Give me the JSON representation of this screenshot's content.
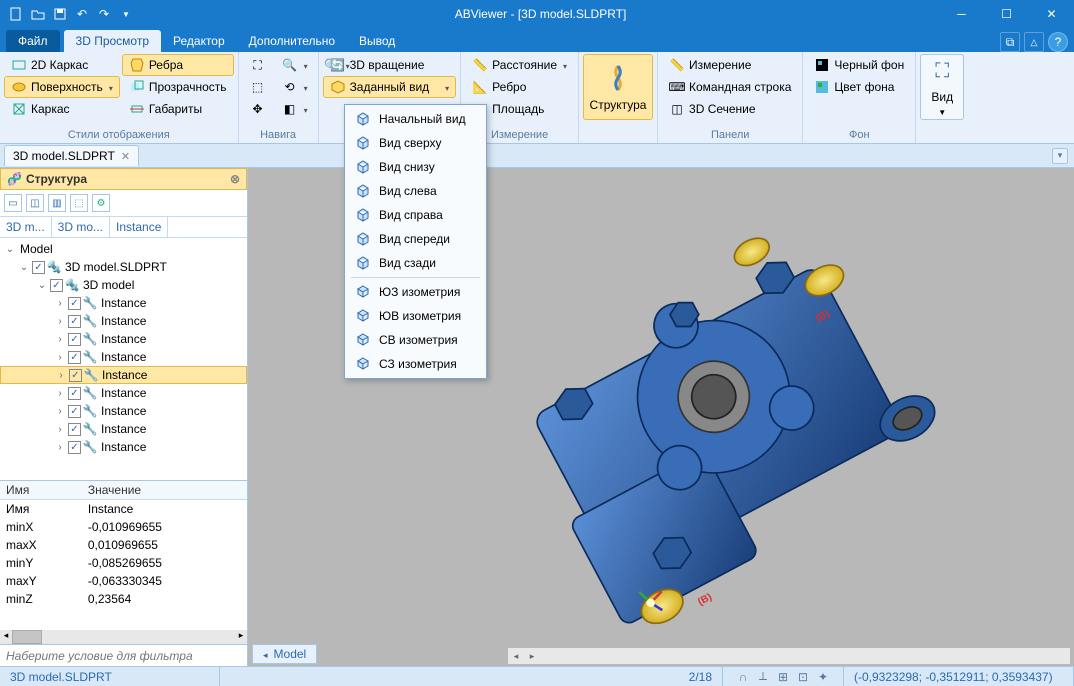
{
  "titlebar": {
    "title": "ABViewer  - [3D model.SLDPRT]"
  },
  "tabs": {
    "file": "Файл",
    "items": [
      "3D Просмотр",
      "Редактор",
      "Дополнительно",
      "Вывод"
    ],
    "active": 0
  },
  "ribbon": {
    "styles": {
      "label": "Стили отображения",
      "btn_wireframe": "2D Каркас",
      "btn_edges": "Ребра",
      "btn_surface": "Поверхность",
      "btn_transparency": "Прозрачность",
      "btn_frame": "Каркас",
      "btn_dims": "Габариты"
    },
    "nav": {
      "label": "Навига"
    },
    "rotate": {
      "btn_rotate": "3D вращение",
      "btn_view": "Заданный вид"
    },
    "measure": {
      "label": "Измерение",
      "btn_distance": "Расстояние",
      "btn_edge": "Ребро",
      "btn_area": "Площадь"
    },
    "structure": {
      "btn": "Структура"
    },
    "panels": {
      "label": "Панели",
      "btn_measure": "Измерение",
      "btn_cmd": "Командная строка",
      "btn_section": "3D Сечение"
    },
    "background": {
      "label": "Фон",
      "btn_black": "Черный фон",
      "btn_color": "Цвет фона"
    },
    "view": {
      "btn": "Вид"
    }
  },
  "dropdown": {
    "items": [
      "Начальный вид",
      "Вид сверху",
      "Вид снизу",
      "Вид слева",
      "Вид справа",
      "Вид спереди",
      "Вид сзади"
    ],
    "iso": [
      "ЮЗ изометрия",
      "ЮВ изометрия",
      "СВ изометрия",
      "СЗ изометрия"
    ]
  },
  "doctab": "3D model.SLDPRT",
  "structure_panel": {
    "title": "Структура",
    "headers": [
      "3D m...",
      "3D mo...",
      "Instance"
    ],
    "tree": {
      "root": "Model",
      "file": "3D model.SLDPRT",
      "model": "3D model",
      "instances": [
        "Instance",
        "Instance",
        "Instance",
        "Instance",
        "Instance",
        "Instance",
        "Instance",
        "Instance",
        "Instance"
      ],
      "selected_index": 4
    },
    "props": {
      "col_name": "Имя",
      "col_value": "Значение",
      "rows": [
        {
          "k": "Имя",
          "v": "Instance"
        },
        {
          "k": "minX",
          "v": "-0,010969655"
        },
        {
          "k": "maxX",
          "v": "0,010969655"
        },
        {
          "k": "minY",
          "v": "-0,085269655"
        },
        {
          "k": "maxY",
          "v": "-0,063330345"
        },
        {
          "k": "minZ",
          "v": "0,23564"
        }
      ]
    },
    "filter_placeholder": "Наберите условие для фильтра"
  },
  "viewport": {
    "tab": "Model",
    "annotation": "(B)"
  },
  "statusbar": {
    "file": "3D model.SLDPRT",
    "pages": "2/18",
    "coords": "(-0,9323298; -0,3512911; 0,3593437)"
  }
}
